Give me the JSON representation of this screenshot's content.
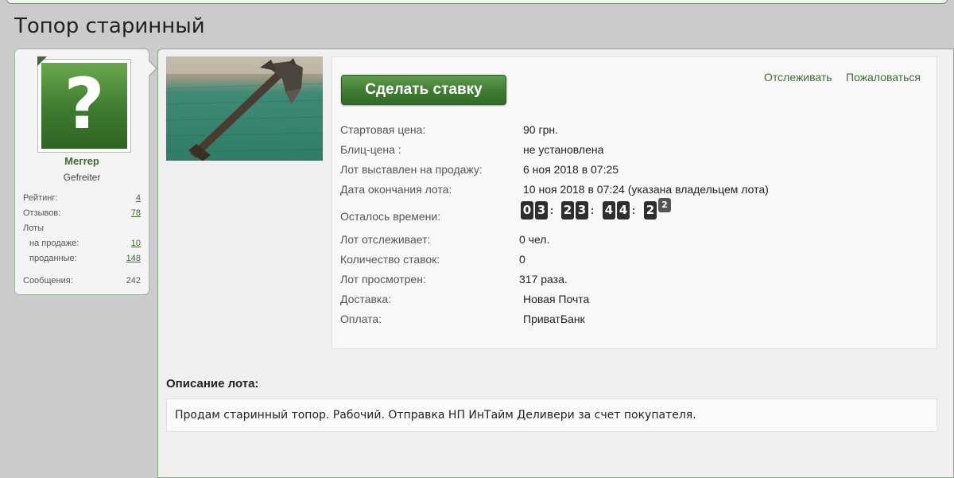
{
  "page": {
    "title": "Топор старинный"
  },
  "seller": {
    "username": "Meгrep",
    "user_title": "Gefreiter",
    "stats": [
      {
        "label": "Рейтинг:",
        "value": "4",
        "link": true
      },
      {
        "label": "Отзывов:",
        "value": "78",
        "link": true
      },
      {
        "label": "Лоты",
        "value": "",
        "link": false
      },
      {
        "label": "на продаже:",
        "value": "10",
        "link": true
      },
      {
        "label": "проданные:",
        "value": "148",
        "link": true
      },
      {
        "label": "Сообщения:",
        "value": "242",
        "link": false
      }
    ]
  },
  "actions": {
    "bid_label": "Сделать ставку",
    "follow_label": "Отслеживать",
    "report_label": "Пожаловаться"
  },
  "lot": {
    "rows": [
      {
        "label": "Стартовая цена:",
        "value": "90 грн."
      },
      {
        "label": "Блиц-цена :",
        "value": "не установлена"
      },
      {
        "label": "Лот выставлен на продажу:",
        "value": "6 ноя 2018 в 07:25"
      },
      {
        "label": "Дата окончания лота:",
        "value": "10 ноя 2018 в 07:24 (указана владельцем лота)"
      },
      {
        "label": "Осталось времени:",
        "value": ""
      },
      {
        "label": "Лот отслеживает:",
        "value": "0 чел."
      },
      {
        "label": "Количество ставок:",
        "value": "0"
      },
      {
        "label": "Лот просмотрен:",
        "value": "317 раза."
      },
      {
        "label": "Доставка:",
        "value": "Новая Почта"
      },
      {
        "label": "Оплата:",
        "value": "ПриватБанк"
      }
    ],
    "countdown": {
      "digits": [
        "0",
        "3",
        "2",
        "3",
        "4",
        "4",
        "2",
        "2"
      ],
      "separator": ":"
    }
  },
  "description": {
    "title": "Описание лота:",
    "text": "Продам старинный топор. Рабочий. Отправка НП ИнТайм Деливери за счет покупателя."
  },
  "colors": {
    "accent": "#3c6e2f",
    "button": "#3e7a2f",
    "panel_border": "#8aa88a"
  },
  "icons": {
    "avatar": "question-mark-icon"
  }
}
